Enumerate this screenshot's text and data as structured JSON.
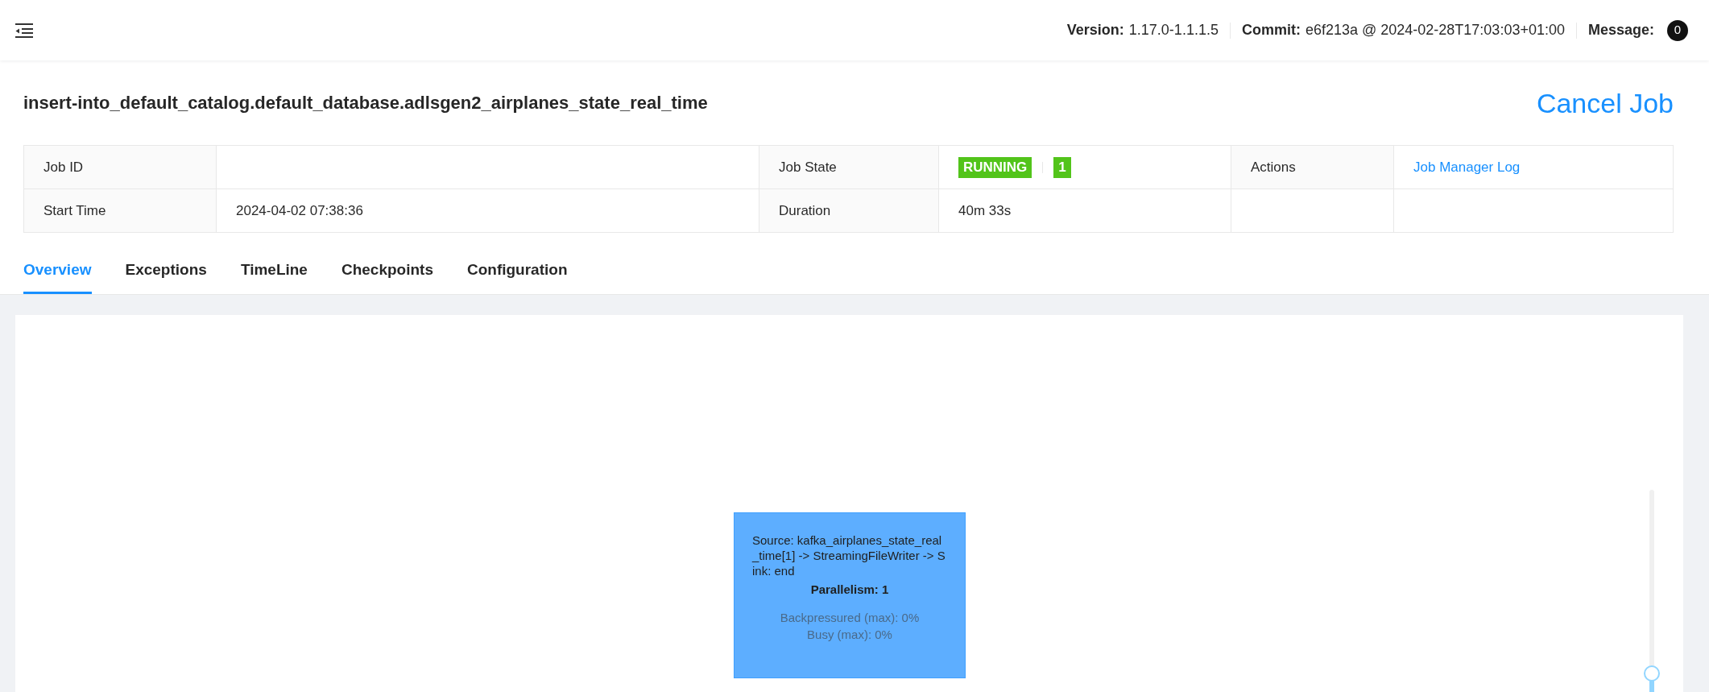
{
  "header": {
    "version_label": "Version:",
    "version": "1.17.0-1.1.1.5",
    "commit_label": "Commit:",
    "commit": "e6f213a @ 2024-02-28T17:03:03+01:00",
    "message_label": "Message:",
    "message_count": "0"
  },
  "job": {
    "title": "insert-into_default_catalog.default_database.adlsgen2_airplanes_state_real_time",
    "cancel": "Cancel Job"
  },
  "info_table": {
    "rows": [
      {
        "cells": [
          {
            "kind": "label",
            "text": "Job ID"
          },
          {
            "kind": "empty"
          },
          {
            "kind": "label",
            "text": "Job State"
          },
          {
            "kind": "status",
            "badges": [
              "RUNNING",
              "1"
            ]
          },
          {
            "kind": "label",
            "text": "Actions"
          },
          {
            "kind": "link",
            "text": "Job Manager Log"
          }
        ]
      },
      {
        "cells": [
          {
            "kind": "label",
            "text": "Start Time"
          },
          {
            "kind": "value",
            "text": "2024-04-02 07:38:36"
          },
          {
            "kind": "label",
            "text": "Duration"
          },
          {
            "kind": "value",
            "text": "40m 33s"
          },
          {
            "kind": "empty"
          },
          {
            "kind": "empty"
          }
        ]
      }
    ]
  },
  "tabs": [
    {
      "label": "Overview",
      "selected": true
    },
    {
      "label": "Exceptions",
      "selected": false
    },
    {
      "label": "TimeLine",
      "selected": false
    },
    {
      "label": "Checkpoints",
      "selected": false
    },
    {
      "label": "Configuration",
      "selected": false
    }
  ],
  "graph": {
    "node": {
      "name": "Source: kafka_airplanes_state_real_time[1] -> StreamingFileWriter -> Sink: end",
      "parallelism": "Parallelism: 1",
      "metrics": [
        "Backpressured (max): 0%",
        "Busy (max): 0%"
      ]
    },
    "zoom_slider": {
      "level": 0.09
    }
  }
}
